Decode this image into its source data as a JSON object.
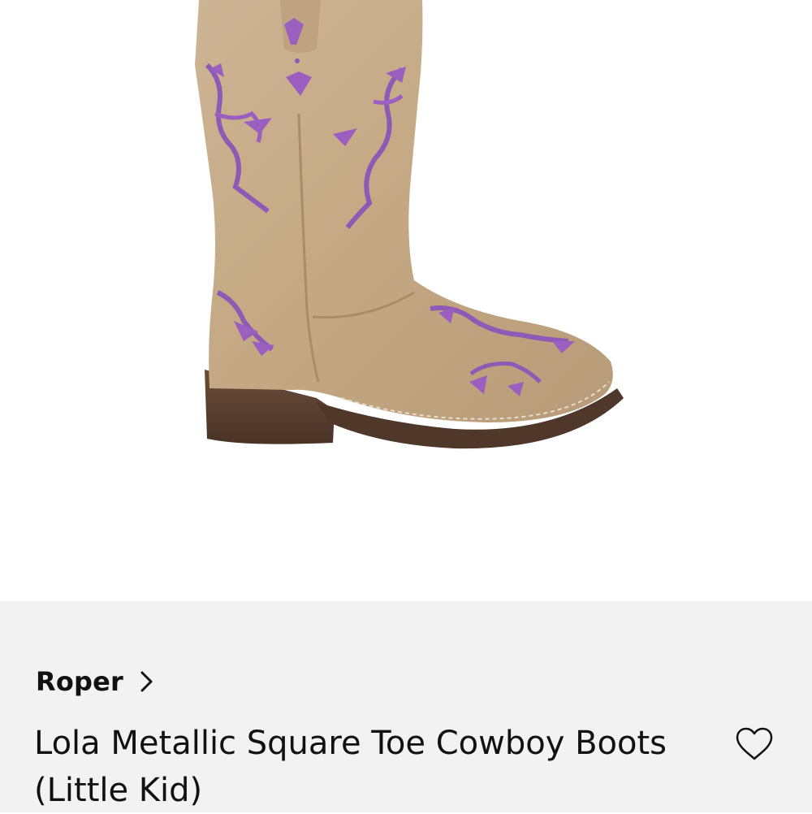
{
  "product": {
    "image_icon": "cowboy-boot-image",
    "brand": "Roper",
    "brand_chevron_icon": "chevron-right-icon",
    "title": "Lola Metallic Square Toe Cowboy Boots (Little Kid)",
    "favorite_icon": "heart-outline-icon"
  },
  "colors": {
    "boot_leather": "#c8ad8a",
    "boot_shadow": "#b39674",
    "inlay_purple": "#9b5fc0",
    "sole": "#5a4132",
    "panel_bg": "#f2f2f2"
  }
}
